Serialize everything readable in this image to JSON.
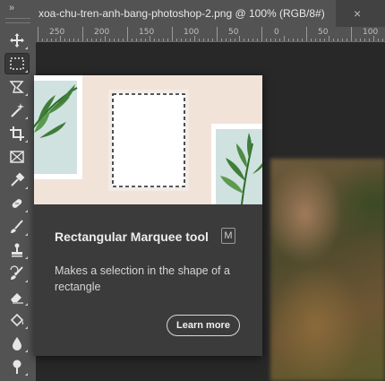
{
  "toolbar": {
    "collapse_label": "»",
    "tools": [
      {
        "icon": "move-icon",
        "active": false
      },
      {
        "icon": "rectangular-marquee-icon",
        "active": true
      },
      {
        "icon": "lasso-icon",
        "active": false
      },
      {
        "icon": "magic-wand-icon",
        "active": false
      },
      {
        "icon": "crop-icon",
        "active": false
      },
      {
        "icon": "frame-icon",
        "active": false
      },
      {
        "icon": "eyedropper-icon",
        "active": false
      },
      {
        "icon": "healing-brush-icon",
        "active": false
      },
      {
        "icon": "brush-icon",
        "active": false
      },
      {
        "icon": "clone-stamp-icon",
        "active": false
      },
      {
        "icon": "history-brush-icon",
        "active": false
      },
      {
        "icon": "eraser-icon",
        "active": false
      },
      {
        "icon": "paint-bucket-icon",
        "active": false
      },
      {
        "icon": "blur-icon",
        "active": false
      },
      {
        "icon": "dodge-icon",
        "active": false
      }
    ]
  },
  "document_tab": {
    "title": "xoa-chu-tren-anh-bang-photoshop-2.png @ 100% (RGB/8#)",
    "close_label": "×"
  },
  "ruler": {
    "labels": [
      "250",
      "200",
      "150",
      "100",
      "50",
      "0",
      "50",
      "100"
    ]
  },
  "tooltip": {
    "title": "Rectangular Marquee tool",
    "shortcut": "M",
    "description": "Makes a selection in the shape of a rectangle",
    "learn_more": "Learn more"
  },
  "colors": {
    "toolbar_bg": "#535353",
    "canvas_bg": "#282828",
    "tooltip_bg": "#3b3b3b",
    "illustration_bg": "#f2e3d9",
    "leaf_green": "#3f7d3a"
  }
}
